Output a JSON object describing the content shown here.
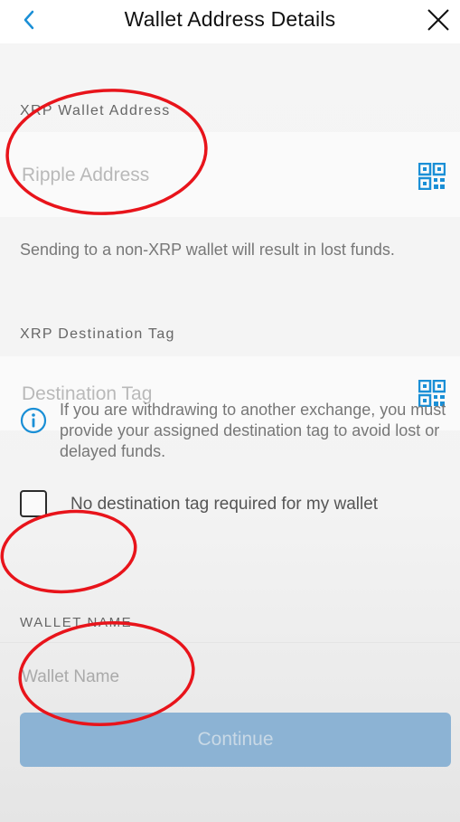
{
  "header": {
    "title": "Wallet Address Details",
    "back_icon": "chevron-left-icon",
    "close_icon": "close-icon"
  },
  "address": {
    "label": "XRP Wallet Address",
    "placeholder": "Ripple Address",
    "value": "",
    "helper": "Sending to a non-XRP wallet will result in lost funds."
  },
  "destination_tag": {
    "label": "XRP Destination Tag",
    "placeholder": "Destination Tag",
    "value": "",
    "info": "If you are withdrawing to another exchange, you must provide your assigned destination tag to avoid lost or delayed funds."
  },
  "no_tag_checkbox": {
    "label": "No destination tag required for my wallet",
    "checked": false
  },
  "wallet_name": {
    "label": "WALLET NAME",
    "placeholder": "Wallet Name",
    "value": ""
  },
  "footer": {
    "continue_label": "Continue"
  },
  "colors": {
    "accent": "#1a8fd6",
    "button_disabled": "#8cb3d4",
    "annotation": "#e8141b"
  }
}
